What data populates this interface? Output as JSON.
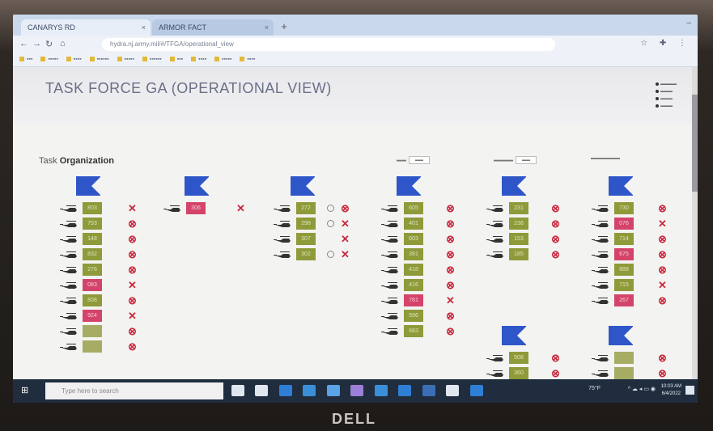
{
  "brand": "DELL",
  "browser": {
    "tabs": [
      {
        "label": "CANARYS RD"
      },
      {
        "label": "ARMOR FACT"
      }
    ],
    "url": "hydra.nj.army.mil/#/TFGA/operational_view"
  },
  "page": {
    "title": "TASK FORCE GA (OPERATIONAL VIEW)",
    "org_title_prefix": "Task",
    "org_title_bold": "Organization"
  },
  "units": [
    {
      "rows": [
        {
          "tail": "803",
          "status": "green",
          "mark": "x"
        },
        {
          "tail": "753",
          "status": "green",
          "mark": "oc"
        },
        {
          "tail": "148",
          "status": "green",
          "mark": "oc"
        },
        {
          "tail": "832",
          "status": "green",
          "mark": "oc"
        },
        {
          "tail": "276",
          "status": "green",
          "mark": "oc"
        },
        {
          "tail": "083",
          "status": "red",
          "mark": "x"
        },
        {
          "tail": "808",
          "status": "green",
          "mark": "oc"
        },
        {
          "tail": "924",
          "status": "red",
          "mark": "x"
        },
        {
          "tail": "",
          "status": "empty",
          "mark": "oc"
        },
        {
          "tail": "",
          "status": "empty",
          "mark": "oc"
        }
      ]
    },
    {
      "rows": [
        {
          "tail": "306",
          "status": "red",
          "mark": "x"
        }
      ]
    },
    {
      "rows": [
        {
          "tail": "272",
          "status": "green",
          "mark": "oc",
          "circle": true
        },
        {
          "tail": "298",
          "status": "green",
          "mark": "x",
          "circle": true
        },
        {
          "tail": "307",
          "status": "green",
          "mark": "x"
        },
        {
          "tail": "302",
          "status": "green",
          "mark": "x",
          "circle": true
        }
      ]
    },
    {
      "rows": [
        {
          "tail": "605",
          "status": "green",
          "mark": "oc"
        },
        {
          "tail": "401",
          "status": "green",
          "mark": "oc"
        },
        {
          "tail": "603",
          "status": "green",
          "mark": "oc"
        },
        {
          "tail": "391",
          "status": "green",
          "mark": "oc"
        },
        {
          "tail": "418",
          "status": "green",
          "mark": "oc"
        },
        {
          "tail": "416",
          "status": "green",
          "mark": "oc"
        },
        {
          "tail": "781",
          "status": "red",
          "mark": "x"
        },
        {
          "tail": "596",
          "status": "green",
          "mark": "oc"
        },
        {
          "tail": "683",
          "status": "green",
          "mark": "oc"
        }
      ]
    },
    {
      "rows": [
        {
          "tail": "231",
          "status": "green",
          "mark": "oc"
        },
        {
          "tail": "238",
          "status": "green",
          "mark": "oc"
        },
        {
          "tail": "153",
          "status": "green",
          "mark": "oc"
        },
        {
          "tail": "185",
          "status": "green",
          "mark": "oc"
        }
      ]
    },
    {
      "rows": [
        {
          "tail": "730",
          "status": "green",
          "mark": "oc"
        },
        {
          "tail": "076",
          "status": "red",
          "mark": "x"
        },
        {
          "tail": "714",
          "status": "green",
          "mark": "oc"
        },
        {
          "tail": "675",
          "status": "red",
          "mark": "oc"
        },
        {
          "tail": "888",
          "status": "green",
          "mark": "oc"
        },
        {
          "tail": "715",
          "status": "green",
          "mark": "x"
        },
        {
          "tail": "267",
          "status": "red",
          "mark": "oc"
        }
      ]
    },
    {
      "rows": [
        {
          "tail": "508",
          "status": "green",
          "mark": "oc"
        },
        {
          "tail": "360",
          "status": "green",
          "mark": "oc"
        }
      ]
    },
    {
      "rows": [
        {
          "tail": "",
          "status": "empty",
          "mark": "oc"
        },
        {
          "tail": "",
          "status": "empty",
          "mark": "oc"
        },
        {
          "tail": "",
          "status": "empty",
          "mark": "oc"
        }
      ]
    }
  ],
  "taskbar": {
    "search_placeholder": "Type here to search",
    "temp": "75°F",
    "time": "10:03 AM",
    "date": "6/4/2022"
  },
  "colors": {
    "flag": "#2f56c9",
    "ok": "#8f9a3a",
    "down": "#d4446a",
    "mark": "#c8283e"
  }
}
